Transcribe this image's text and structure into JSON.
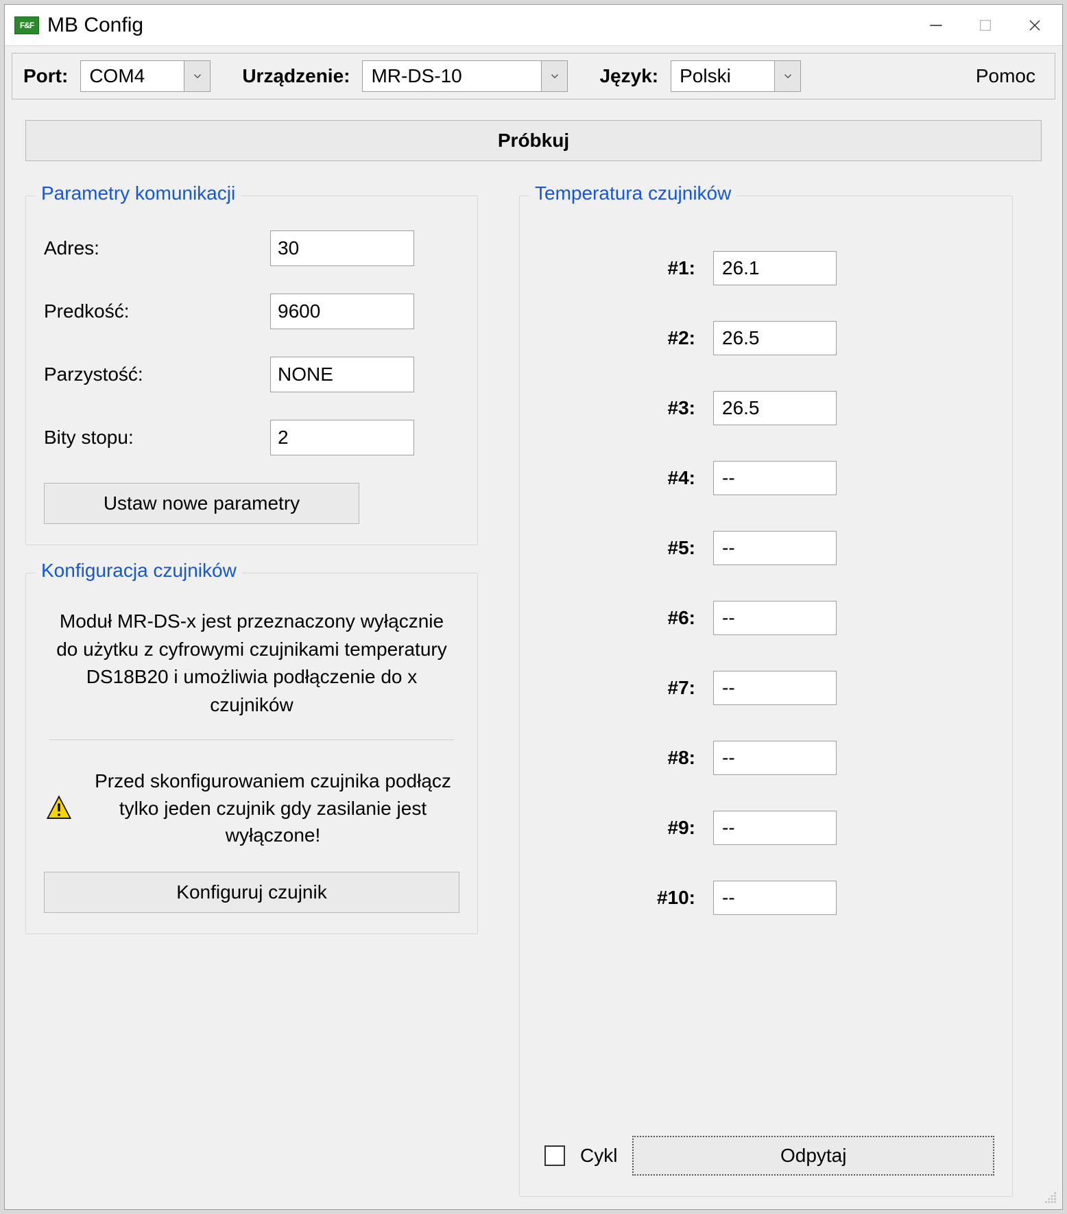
{
  "title": "MB Config",
  "app_icon_text": "F&F",
  "toolbar": {
    "port_label": "Port:",
    "port_value": "COM4",
    "device_label": "Urządzenie:",
    "device_value": "MR-DS-10",
    "lang_label": "Język:",
    "lang_value": "Polski",
    "help_label": "Pomoc"
  },
  "sample_button": "Próbkuj",
  "comm": {
    "title": "Parametry komunikacji",
    "address_label": "Adres:",
    "address_value": "30",
    "speed_label": "Predkość:",
    "speed_value": "9600",
    "parity_label": "Parzystość:",
    "parity_value": "NONE",
    "stopbits_label": "Bity stopu:",
    "stopbits_value": "2",
    "set_button": "Ustaw nowe parametry"
  },
  "cfg": {
    "title": "Konfiguracja czujników",
    "info": "Moduł MR-DS-x jest przeznaczony wyłącznie do użytku z cyfrowymi czujnikami temperatury DS18B20 i umożliwia podłączenie do x czujników",
    "warn": "Przed skonfigurowaniem czujnika podłącz tylko jeden czujnik gdy zasilanie jest wyłączone!",
    "button": "Konfiguruj czujnik"
  },
  "temps": {
    "title": "Temperatura czujników",
    "rows": [
      {
        "label": "#1:",
        "value": "26.1"
      },
      {
        "label": "#2:",
        "value": "26.5"
      },
      {
        "label": "#3:",
        "value": "26.5"
      },
      {
        "label": "#4:",
        "value": "--"
      },
      {
        "label": "#5:",
        "value": "--"
      },
      {
        "label": "#6:",
        "value": "--"
      },
      {
        "label": "#7:",
        "value": "--"
      },
      {
        "label": "#8:",
        "value": "--"
      },
      {
        "label": "#9:",
        "value": "--"
      },
      {
        "label": "#10:",
        "value": "--"
      }
    ],
    "cycle_label": "Cykl",
    "query_button": "Odpytaj"
  }
}
